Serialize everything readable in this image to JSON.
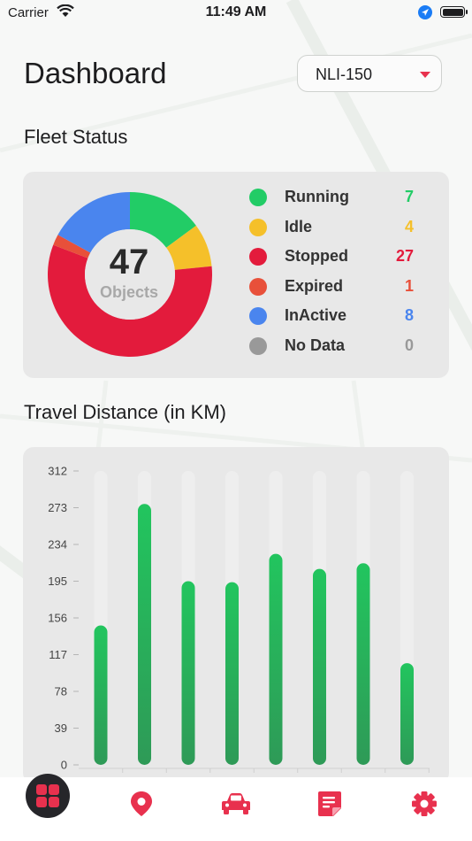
{
  "status_bar": {
    "carrier": "Carrier",
    "time": "11:49 AM"
  },
  "header": {
    "title": "Dashboard",
    "device_select": "NLI-150"
  },
  "fleet_status": {
    "title": "Fleet Status",
    "total": "47",
    "total_label": "Objects",
    "items": [
      {
        "label": "Running",
        "value": "7",
        "color": "#22cc66"
      },
      {
        "label": "Idle",
        "value": "4",
        "color": "#f5c02a"
      },
      {
        "label": "Stopped",
        "value": "27",
        "color": "#e31b3c"
      },
      {
        "label": "Expired",
        "value": "1",
        "color": "#e8503a"
      },
      {
        "label": "InActive",
        "value": "8",
        "color": "#4a85ee"
      },
      {
        "label": "No Data",
        "value": "0",
        "color": "#999999"
      }
    ]
  },
  "travel": {
    "title": "Travel Distance (in KM)",
    "chart_data": {
      "type": "bar",
      "title": "Travel Distance (in KM)",
      "xlabel": "",
      "ylabel": "",
      "ylim": [
        0,
        312
      ],
      "y_ticks": [
        "312",
        "273",
        "234",
        "195",
        "156",
        "117",
        "78",
        "39",
        "0"
      ],
      "values": [
        148,
        277,
        195,
        194,
        224,
        208,
        214,
        108
      ],
      "bar_color": "#22c55e",
      "track_color": "#eeeeee"
    }
  },
  "tab_bar": {
    "tabs": [
      {
        "name": "dashboard-tab",
        "icon": "grid-icon",
        "active": true
      },
      {
        "name": "map-tab",
        "icon": "location-pin-icon"
      },
      {
        "name": "vehicles-tab",
        "icon": "car-icon"
      },
      {
        "name": "reports-tab",
        "icon": "document-icon"
      },
      {
        "name": "settings-tab",
        "icon": "gear-icon"
      }
    ],
    "accent_color": "#e8314e"
  }
}
